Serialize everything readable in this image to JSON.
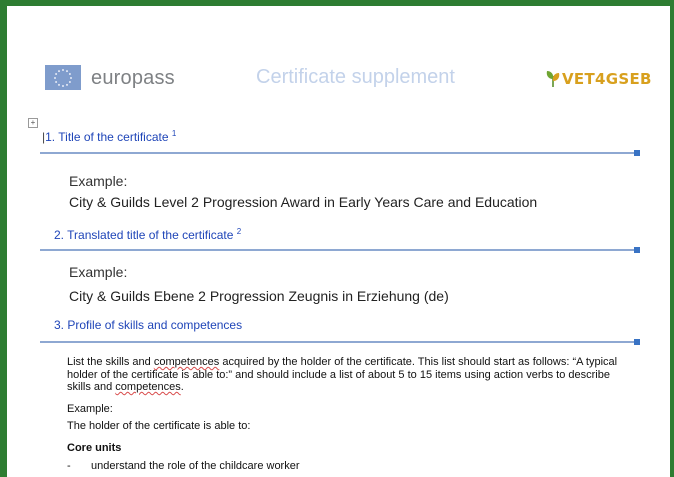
{
  "header": {
    "brand": "europass",
    "document_type": "Certificate supplement",
    "partner_logo": "VET4GSEB",
    "colors": {
      "frame_green": "#2e7d32",
      "section_blue": "#1f45b8",
      "logo_gold": "#d8a01e"
    }
  },
  "sections": [
    {
      "number": "1.",
      "title": "Title of the certificate",
      "footnote": "1",
      "example_label": "Example:",
      "example_text": "City & Guilds Level 2 Progression Award in Early Years Care and Education"
    },
    {
      "number": "2.",
      "title": "Translated title of the certificate",
      "footnote": "2",
      "example_label": "Example:",
      "example_text": "City & Guilds Ebene 2 Progression Zeugnis in Erziehung (de)"
    },
    {
      "number": "3.",
      "title": "Profile of skills and competences",
      "footnote": ""
    }
  ],
  "skills": {
    "instruction_line1_a": "List the skills and ",
    "instruction_line1_b": "competences",
    "instruction_line1_c": " acquired by the holder of the certificate. This list should start as follows: “A typical",
    "instruction_line2": "holder of the certificate is able to:” and should include a list of about 5 to 15 items using action verbs to describe",
    "instruction_line3_a": "skills and ",
    "instruction_line3_b": "competences",
    "instruction_line3_c": ".",
    "example_label": "Example:",
    "holder_line": "The holder of the certificate is able to:",
    "core_units_heading": "Core units",
    "bullet_dash": "-",
    "bullet_1": "understand the role of the childcare worker"
  },
  "icons": {
    "flag": "eu-flag-icon",
    "leaf": "leaf-icon",
    "expand": "expand-box-icon"
  }
}
